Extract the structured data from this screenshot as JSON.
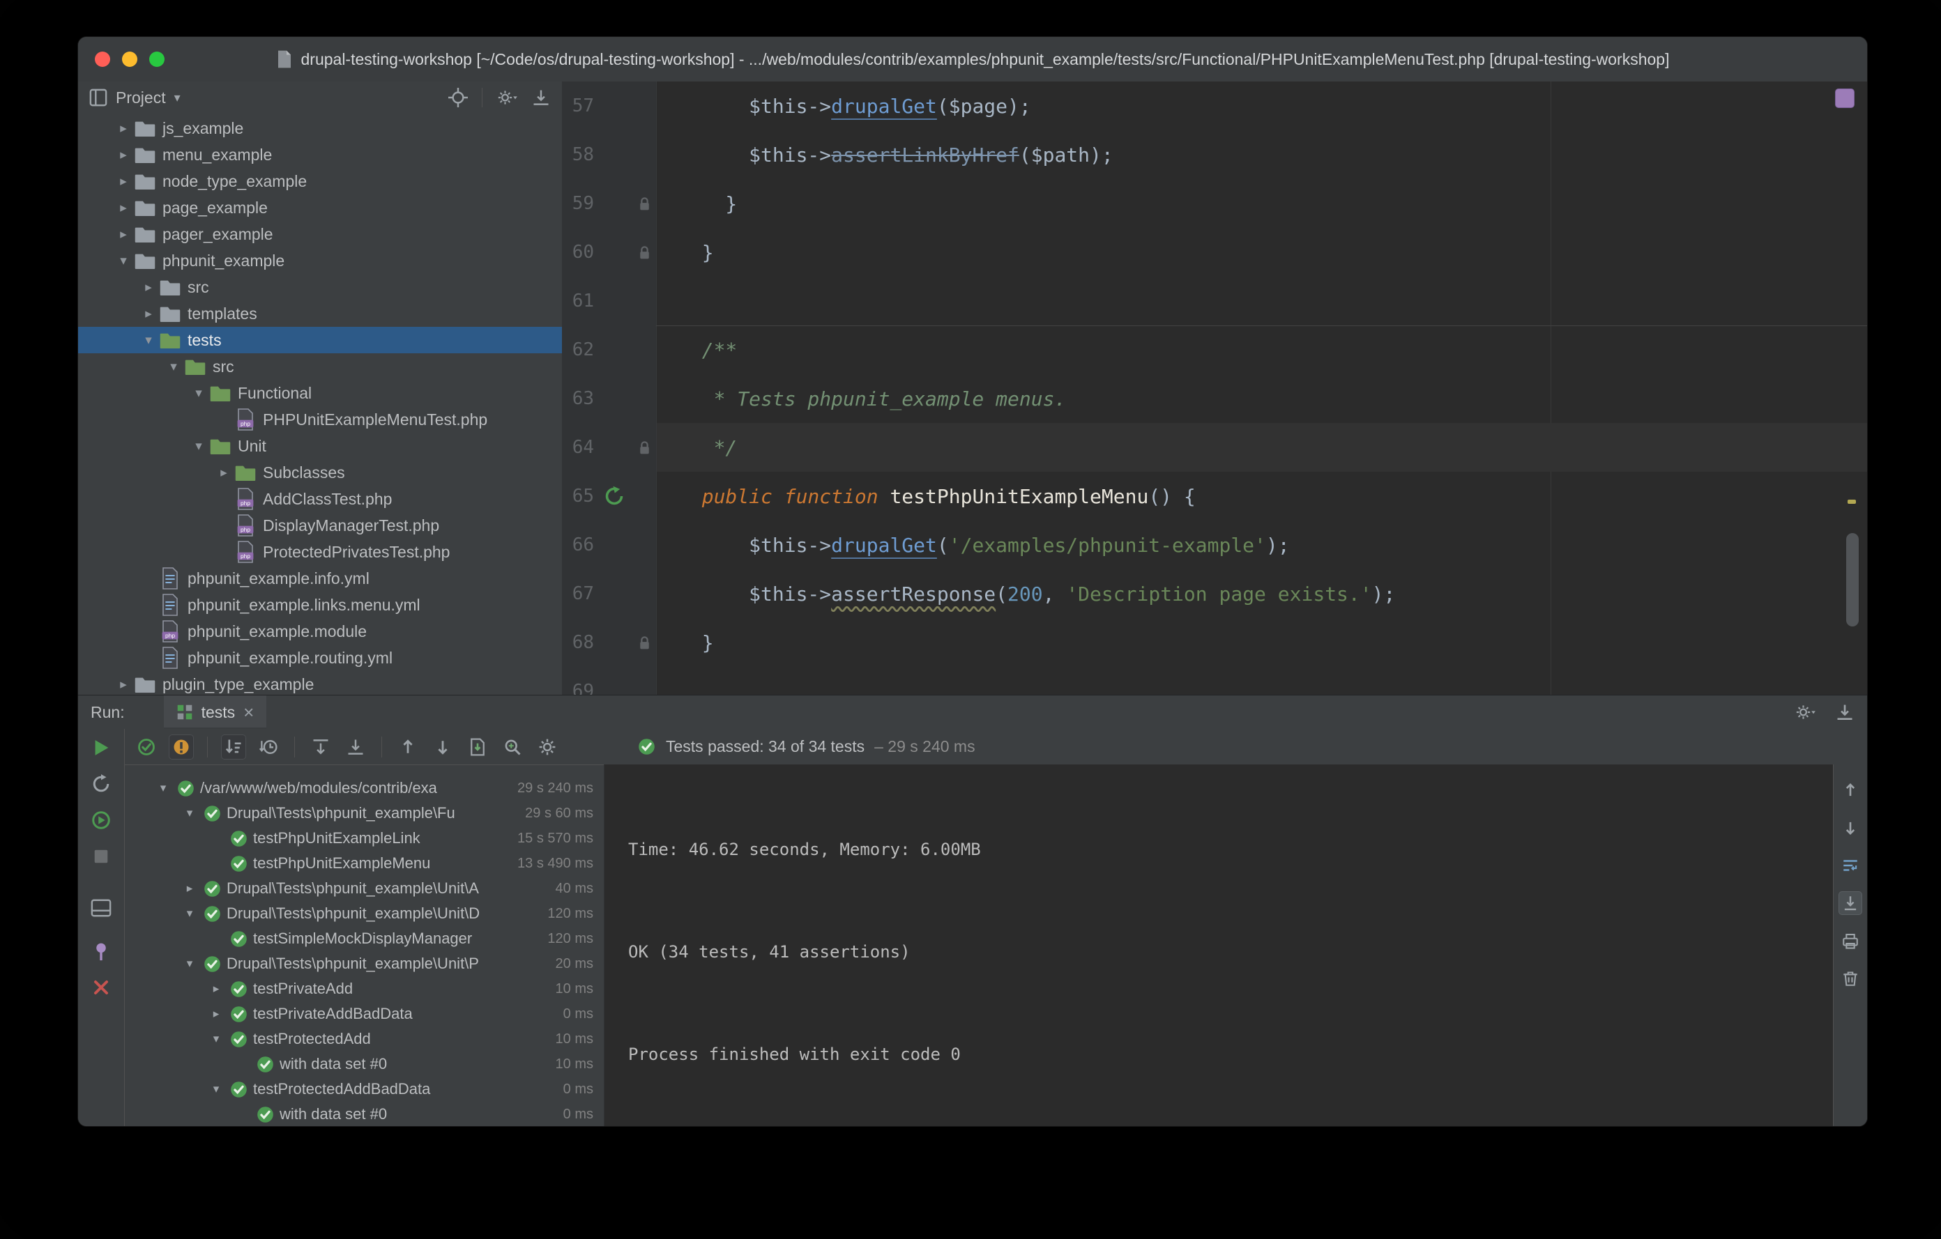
{
  "window": {
    "title": "drupal-testing-workshop [~/Code/os/drupal-testing-workshop] - .../web/modules/contrib/examples/phpunit_example/tests/src/Functional/PHPUnitExampleMenuTest.php [drupal-testing-workshop]"
  },
  "icons": {
    "expand_open": "▾",
    "expand_closed": "▸",
    "caret_down": "▾",
    "close": "×"
  },
  "project_panel": {
    "title": "Project",
    "tree": [
      {
        "label": "js_example",
        "level": 0,
        "icon": "folder",
        "expand": "closed"
      },
      {
        "label": "menu_example",
        "level": 0,
        "icon": "folder",
        "expand": "closed"
      },
      {
        "label": "node_type_example",
        "level": 0,
        "icon": "folder",
        "expand": "closed"
      },
      {
        "label": "page_example",
        "level": 0,
        "icon": "folder",
        "expand": "closed"
      },
      {
        "label": "pager_example",
        "level": 0,
        "icon": "folder",
        "expand": "closed"
      },
      {
        "label": "phpunit_example",
        "level": 0,
        "icon": "folder",
        "expand": "open"
      },
      {
        "label": "src",
        "level": 1,
        "icon": "folder",
        "expand": "closed"
      },
      {
        "label": "templates",
        "level": 1,
        "icon": "folder",
        "expand": "closed"
      },
      {
        "label": "tests",
        "level": 1,
        "icon": "folder-test",
        "expand": "open",
        "selected": true
      },
      {
        "label": "src",
        "level": 2,
        "icon": "folder-test",
        "expand": "open"
      },
      {
        "label": "Functional",
        "level": 3,
        "icon": "folder-test",
        "expand": "open"
      },
      {
        "label": "PHPUnitExampleMenuTest.php",
        "level": 4,
        "icon": "php",
        "expand": "none"
      },
      {
        "label": "Unit",
        "level": 3,
        "icon": "folder-test",
        "expand": "open"
      },
      {
        "label": "Subclasses",
        "level": 4,
        "icon": "folder-test",
        "expand": "closed"
      },
      {
        "label": "AddClassTest.php",
        "level": 4,
        "icon": "php",
        "expand": "none"
      },
      {
        "label": "DisplayManagerTest.php",
        "level": 4,
        "icon": "php",
        "expand": "none"
      },
      {
        "label": "ProtectedPrivatesTest.php",
        "level": 4,
        "icon": "php",
        "expand": "none"
      },
      {
        "label": "phpunit_example.info.yml",
        "level": 1,
        "icon": "yml",
        "expand": "none"
      },
      {
        "label": "phpunit_example.links.menu.yml",
        "level": 1,
        "icon": "yml",
        "expand": "none"
      },
      {
        "label": "phpunit_example.module",
        "level": 1,
        "icon": "php",
        "expand": "none"
      },
      {
        "label": "phpunit_example.routing.yml",
        "level": 1,
        "icon": "yml",
        "expand": "none"
      },
      {
        "label": "plugin_type_example",
        "level": 0,
        "icon": "folder",
        "expand": "closed"
      }
    ]
  },
  "editor": {
    "lines": [
      {
        "num": "57",
        "segs": [
          [
            "sp",
            "      $this->"
          ],
          [
            "sm",
            "drupalGet"
          ],
          [
            "sp",
            "($page);"
          ]
        ]
      },
      {
        "num": "58",
        "segs": [
          [
            "sp",
            "      $this->"
          ],
          [
            "sd",
            "assertLinkByHref"
          ],
          [
            "sp",
            "($path);"
          ]
        ]
      },
      {
        "num": "59",
        "gutter": "lock",
        "segs": [
          [
            "sp",
            "    }"
          ]
        ]
      },
      {
        "num": "60",
        "gutter": "lock",
        "segs": [
          [
            "sp",
            "  }"
          ]
        ]
      },
      {
        "num": "61",
        "segs": []
      },
      {
        "num": "62",
        "sep": true,
        "segs": [
          [
            "sc",
            "  /**"
          ]
        ]
      },
      {
        "num": "63",
        "segs": [
          [
            "sc",
            "   * Tests phpunit_example menus."
          ]
        ]
      },
      {
        "num": "64",
        "gutter": "lock",
        "active": true,
        "segs": [
          [
            "sc",
            "   */"
          ]
        ]
      },
      {
        "num": "65",
        "gutter": "run",
        "segs": [
          [
            "sk",
            "  public function "
          ],
          [
            "sf",
            "testPhpUnitExampleMenu"
          ],
          [
            "sp",
            "() {"
          ]
        ]
      },
      {
        "num": "66",
        "segs": [
          [
            "sp",
            "      $this->"
          ],
          [
            "sm",
            "drupalGet"
          ],
          [
            "sp",
            "("
          ],
          [
            "ss",
            "'/examples/phpunit-example'"
          ],
          [
            "sp",
            ");"
          ]
        ]
      },
      {
        "num": "67",
        "segs": [
          [
            "sp",
            "      $this->"
          ],
          [
            "sw",
            "assertResponse"
          ],
          [
            "sp",
            "("
          ],
          [
            "sn",
            "200"
          ],
          [
            "sp",
            ", "
          ],
          [
            "ss",
            "'Description page exists.'"
          ],
          [
            "sp",
            ");"
          ]
        ]
      },
      {
        "num": "68",
        "gutter": "lock",
        "segs": [
          [
            "sp",
            "  }"
          ]
        ]
      },
      {
        "num": "69",
        "segs": []
      }
    ]
  },
  "run_panel": {
    "label": "Run:",
    "tab": {
      "label": "tests"
    },
    "toolbar_status": {
      "text": "Tests passed: 34 of 34 tests",
      "duration": "– 29 s 240 ms"
    },
    "tests": [
      {
        "label": "/var/www/web/modules/contrib/exa",
        "duration": "29 s 240 ms",
        "level": 0,
        "expand": "open"
      },
      {
        "label": "Drupal\\Tests\\phpunit_example\\Fu",
        "duration": "29 s 60 ms",
        "level": 1,
        "expand": "open"
      },
      {
        "label": "testPhpUnitExampleLink",
        "duration": "15 s 570 ms",
        "level": 2,
        "expand": "none"
      },
      {
        "label": "testPhpUnitExampleMenu",
        "duration": "13 s 490 ms",
        "level": 2,
        "expand": "none"
      },
      {
        "label": "Drupal\\Tests\\phpunit_example\\Unit\\A",
        "duration": "40 ms",
        "level": 1,
        "expand": "closed"
      },
      {
        "label": "Drupal\\Tests\\phpunit_example\\Unit\\D",
        "duration": "120 ms",
        "level": 1,
        "expand": "open"
      },
      {
        "label": "testSimpleMockDisplayManager",
        "duration": "120 ms",
        "level": 2,
        "expand": "none"
      },
      {
        "label": "Drupal\\Tests\\phpunit_example\\Unit\\P",
        "duration": "20 ms",
        "level": 1,
        "expand": "open"
      },
      {
        "label": "testPrivateAdd",
        "duration": "10 ms",
        "level": 2,
        "expand": "closed"
      },
      {
        "label": "testPrivateAddBadData",
        "duration": "0 ms",
        "level": 2,
        "expand": "closed"
      },
      {
        "label": "testProtectedAdd",
        "duration": "10 ms",
        "level": 2,
        "expand": "open"
      },
      {
        "label": "with data set #0",
        "duration": "10 ms",
        "level": 3,
        "expand": "none"
      },
      {
        "label": "testProtectedAddBadData",
        "duration": "0 ms",
        "level": 2,
        "expand": "open"
      },
      {
        "label": "with data set #0",
        "duration": "0 ms",
        "level": 3,
        "expand": "none"
      }
    ],
    "console": [
      "Time: 46.62 seconds, Memory: 6.00MB",
      "OK (34 tests, 41 assertions)",
      "Process finished with exit code 0"
    ]
  }
}
